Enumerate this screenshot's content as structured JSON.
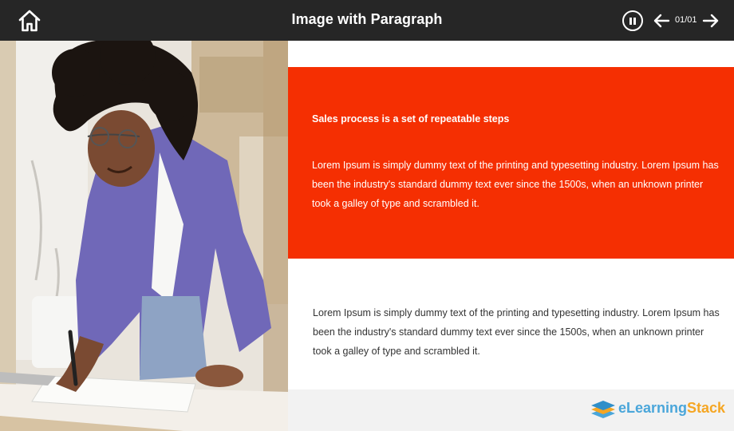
{
  "header": {
    "title": "Image with Paragraph",
    "counter": "01/01"
  },
  "icons": {
    "home": "home-icon",
    "pause": "pause-icon",
    "prev": "arrow-left-icon",
    "next": "arrow-right-icon"
  },
  "colors": {
    "topbar": "#262626",
    "accent": "#f52f02",
    "footer": "#f2f2f2",
    "brand_blue": "#4aa6da",
    "brand_orange": "#f5a623"
  },
  "red_panel": {
    "heading": "Sales process is a set of repeatable steps",
    "body": "Lorem Ipsum is simply dummy text of the printing and typesetting industry. Lorem Ipsum has been the industry's standard dummy text ever since the 1500s, when an unknown printer took a galley of type and scrambled it."
  },
  "white_panel": {
    "body": "Lorem Ipsum is simply dummy text of the printing and typesetting industry. Lorem Ipsum has been the industry's standard dummy text ever since the 1500s, when an unknown printer took a galley of type and scrambled it."
  },
  "footer": {
    "brand_part1": "eLearning",
    "brand_part2": "Stack"
  }
}
